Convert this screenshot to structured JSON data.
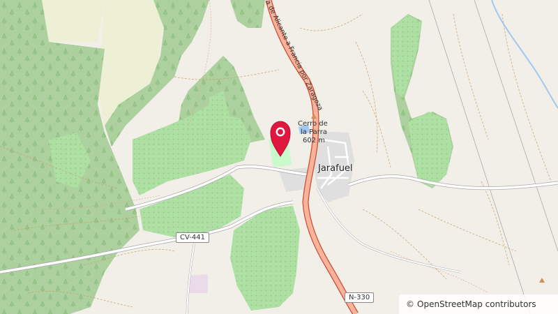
{
  "map": {
    "place_label": "Jarafuel",
    "peak_name_line1": "Cerro de",
    "peak_name_line2": "la Parra",
    "peak_elevation": "602 m",
    "route_label": "a de Alicante a Francia por Zaragoza",
    "road_shields": [
      "CV-441",
      "N-330"
    ],
    "attribution_symbol": "©",
    "attribution_text": "OpenStreetMap contributors",
    "colors": {
      "background": "#f2efe9",
      "forest": "#add19e",
      "orchard": "#aedfa3",
      "farmland": "#eef0d5",
      "trunk_road": "#f9b29c",
      "trunk_road_casing": "#c84e2f",
      "marker": "#e0173e",
      "river": "#a0c8f0"
    },
    "icons": {
      "marker": "map-pin-icon",
      "peak": "peak-triangle-icon"
    }
  }
}
